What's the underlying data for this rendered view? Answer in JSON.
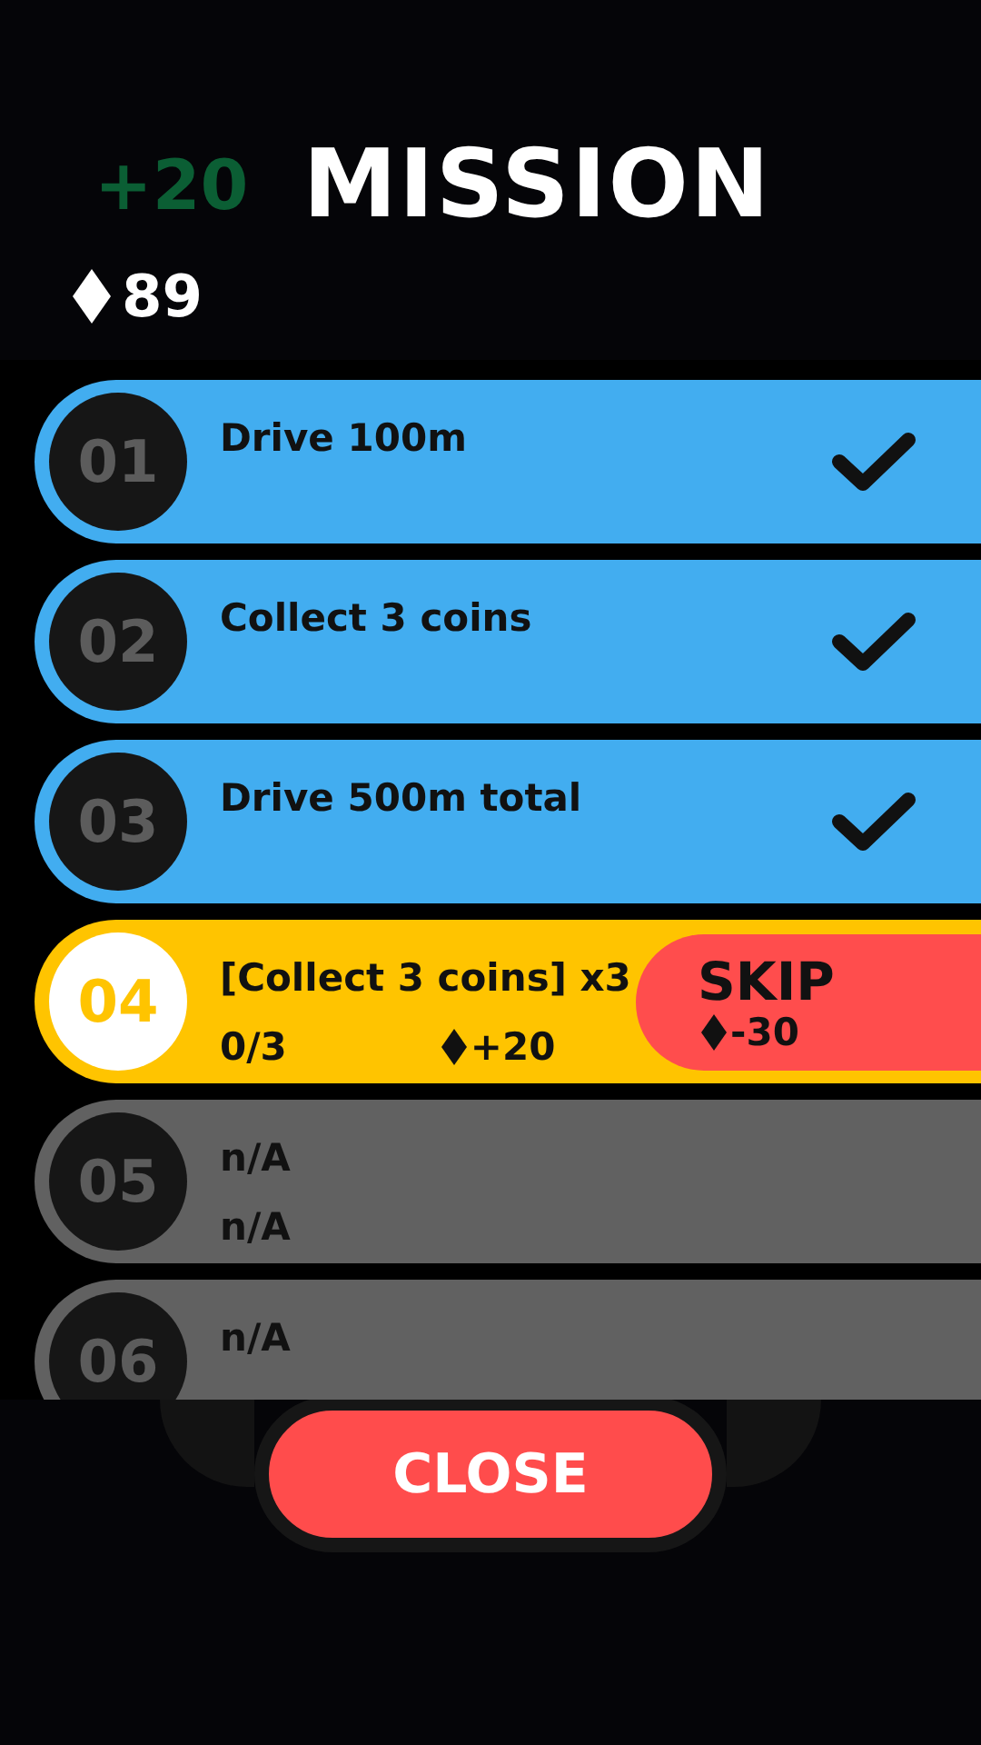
{
  "header": {
    "bonus": "+20",
    "title": "MISSION",
    "balance": "89"
  },
  "missions": [
    {
      "number": "01",
      "title": "Drive 100m",
      "kind": "done"
    },
    {
      "number": "02",
      "title": "Collect 3 coins",
      "kind": "done"
    },
    {
      "number": "03",
      "title": "Drive 500m total",
      "kind": "done"
    },
    {
      "number": "04",
      "title": "[Collect 3 coins] x3",
      "kind": "active",
      "progress": "0/3",
      "reward": "+20",
      "skip": {
        "label": "SKIP",
        "cost": "-30"
      }
    },
    {
      "number": "05",
      "title": "n/A",
      "kind": "locked",
      "progress": "n/A"
    },
    {
      "number": "06",
      "title": "n/A",
      "kind": "locked"
    }
  ],
  "close": "CLOSE"
}
